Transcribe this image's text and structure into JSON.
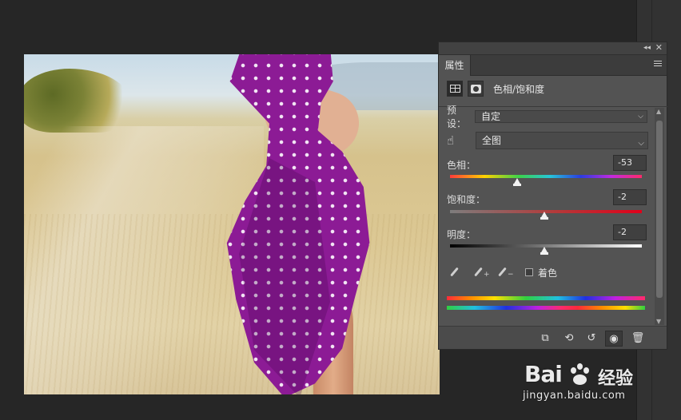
{
  "panel": {
    "collapse_icon": "collapse-icon",
    "close_icon": "close-icon",
    "tab_label": "属性",
    "adjustment_title": "色相/饱和度",
    "preset_label": "预设：",
    "preset_value": "自定",
    "range_value": "全图",
    "hue": {
      "label": "色相：",
      "value": "-53",
      "level": 0.35
    },
    "saturation": {
      "label": "饱和度：",
      "value": "-2",
      "level": 0.49
    },
    "lightness": {
      "label": "明度：",
      "value": "-2",
      "level": 0.49
    },
    "colorize_label": "着色",
    "colorize_checked": false
  },
  "watermark": {
    "brand": "Bai",
    "brand_cn": "经验",
    "url": "jingyan.baidu.com"
  },
  "colors": {
    "panel_bg": "#535353",
    "dress": "#8c1b95",
    "workspace_bg": "#262626"
  }
}
